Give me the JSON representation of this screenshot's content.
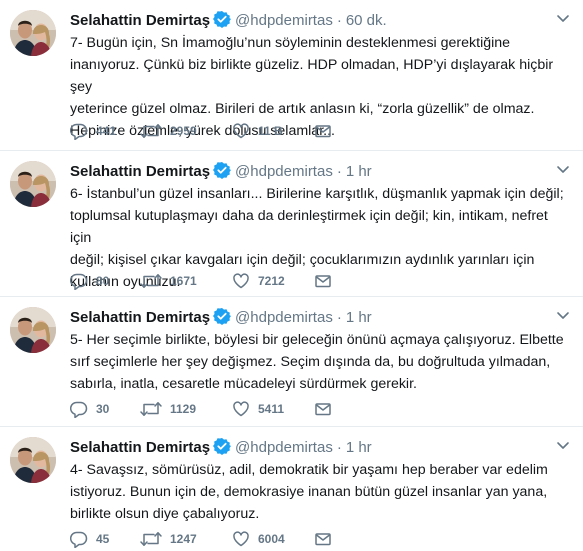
{
  "author": {
    "name": "Selahattin Demirtaş",
    "handle": "@hdpdemirtas",
    "separator": "·"
  },
  "colors": {
    "text": "#14171a",
    "muted": "#657786",
    "verified": "#1da1f2",
    "divider": "#e6ecf0"
  },
  "tweets": [
    {
      "time": "60 dk.",
      "text": "7- Bugün için, Sn İmamoğlu’nun söyleminin desteklenmesi gerektiğine\ninanıyoruz. Çünkü biz birlikte güzeliz. HDP olmadan, HDP’yi dışlayarak hiçbir şey\nyeterince güzel olmaz. Birileri de artık anlasın ki, “zorla güzellik” de olmaz.\nHepinize özlemle, yürek dolusu selamlar...",
      "replies": "441",
      "retweets": "2959",
      "likes": "11 B"
    },
    {
      "time": "1 hr",
      "text": "6- İstanbul’un güzel insanları... Birilerine karşıtlık, düşmanlık yapmak için değil;\ntoplumsal kutuplaşmayı daha da derinleştirmek için değil; kin, intikam, nefret için\ndeğil; kişisel çıkar kavgaları için değil; çocuklarımızın aydınlık yarınları için\nkullanın oyunuzu.",
      "replies": "80",
      "retweets": "1671",
      "likes": "7212"
    },
    {
      "time": "1 hr",
      "text": "5- Her seçimle birlikte, böylesi bir geleceğin önünü açmaya çalışıyoruz. Elbette\nsırf seçimlerle her şey değişmez. Seçim dışında da, bu doğrultuda yılmadan,\nsabırla, inatla, cesaretle mücadeleyi sürdürmek gerekir.",
      "replies": "30",
      "retweets": "1129",
      "likes": "5411"
    },
    {
      "time": "1 hr",
      "text": "4- Savaşsız, sömürüsüz, adil, demokratik bir yaşamı hep beraber var edelim\nistiyoruz. Bunun için de, demokrasiye inanan bütün güzel insanlar yan yana,\nbirlikte olsun diye çabalıyoruz.",
      "replies": "45",
      "retweets": "1247",
      "likes": "6004"
    }
  ]
}
